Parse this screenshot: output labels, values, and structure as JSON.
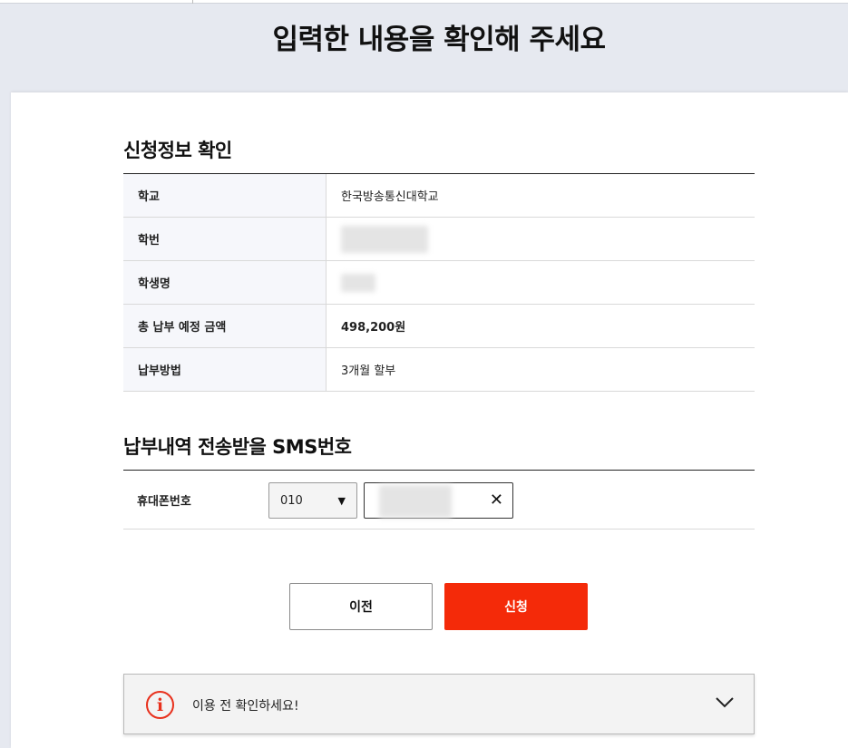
{
  "page": {
    "title": "입력한 내용을 확인해 주세요"
  },
  "application_info": {
    "title": "신청정보 확인",
    "rows": [
      {
        "label": "학교",
        "value": "한국방송통신대학교"
      },
      {
        "label": "학번",
        "value": ""
      },
      {
        "label": "학생명",
        "value": ""
      },
      {
        "label": "총 납부 예정 금액",
        "value": "498,200원"
      },
      {
        "label": "납부방법",
        "value": "3개월 할부"
      }
    ]
  },
  "sms": {
    "title": "납부내역 전송받을 SMS번호",
    "phone_label": "휴대폰번호",
    "prefix_selected": "010",
    "clear_icon": "close-icon"
  },
  "buttons": {
    "prev": "이전",
    "apply": "신청"
  },
  "notice": {
    "text": "이용 전 확인하세요!",
    "icon": "info-icon",
    "icon_glyph": "i",
    "chevron": "chevron-down-icon"
  },
  "colors": {
    "accent": "#f42a09",
    "header_bg": "#e6e9f0",
    "label_bg": "#f6f7fb"
  }
}
